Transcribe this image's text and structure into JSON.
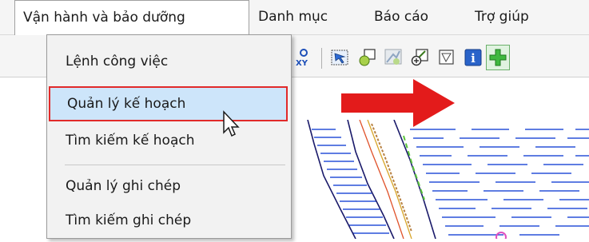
{
  "menubar": {
    "items": [
      {
        "label": "Vận hành và bảo dưỡng"
      },
      {
        "label": "Danh mục"
      },
      {
        "label": "Báo cáo"
      },
      {
        "label": "Trợ giúp"
      }
    ]
  },
  "toolbar": {
    "icons": [
      "xy-coordinate-icon",
      "select-feature-icon",
      "add-feature-icon",
      "edit-feature-icon",
      "zoom-feature-icon",
      "map-frame-icon",
      "info-icon",
      "add-icon"
    ],
    "xy_label": "XY",
    "info_label": "i"
  },
  "dropdown": {
    "items": [
      {
        "label": "Lệnh công việc"
      },
      {
        "label": "Quản lý kế hoạch",
        "highlighted": true
      },
      {
        "label": "Tìm kiếm kế hoạch"
      },
      {
        "label": "Quản lý ghi chép"
      },
      {
        "label": "Tìm kiếm ghi chép"
      }
    ]
  },
  "colors": {
    "highlight_bg": "#cde5fa",
    "highlight_border": "#e12a2a",
    "arrow": "#e31b1b",
    "water_lines": "#2a52d9"
  }
}
